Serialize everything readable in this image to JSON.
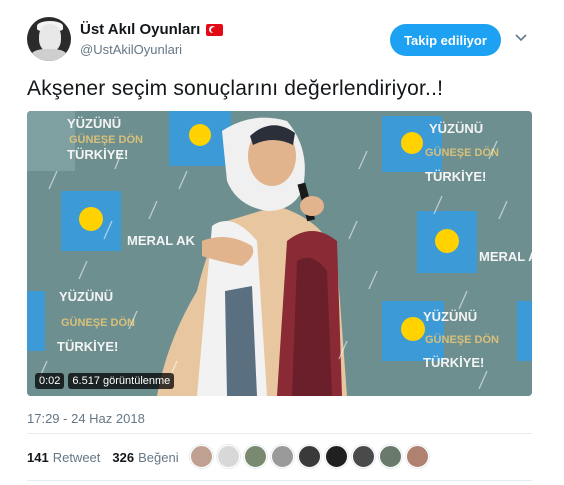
{
  "user": {
    "display_name": "Üst Akıl Oyunları",
    "handle": "@UstAkilOyunlari",
    "flag_icon": "turkey-flag-icon"
  },
  "follow_button": {
    "label": "Takip ediliyor"
  },
  "menu_icon": "chevron-down-icon",
  "tweet": {
    "text": "Akşener seçim sonuçlarını değerlendiriyor..!",
    "timestamp": "17:29 - 24 Haz 2018"
  },
  "video": {
    "duration": "0:02",
    "views": "6.517 görüntülenme",
    "banner_words": [
      "YÜZÜNÜ",
      "GÜNEŞE DÖN",
      "TÜRKİYE!"
    ],
    "banner_name": "MERAL AKŞENER",
    "colors": {
      "teal": "#5f8a8c",
      "yellow": "#ffd200",
      "blue": "#3c9ad6",
      "red": "#9a2a35"
    }
  },
  "stats": {
    "retweet_count": "141",
    "retweet_label": "Retweet",
    "like_count": "326",
    "like_label": "Beğeni"
  },
  "likers": [
    {
      "color": "#c0a090"
    },
    {
      "color": "#d8d8d8"
    },
    {
      "color": "#7a8a70"
    },
    {
      "color": "#9a9a9a"
    },
    {
      "color": "#3a3a3a"
    },
    {
      "color": "#202020"
    },
    {
      "color": "#4a4a4a"
    },
    {
      "color": "#6a7a6a"
    },
    {
      "color": "#b08070"
    }
  ]
}
